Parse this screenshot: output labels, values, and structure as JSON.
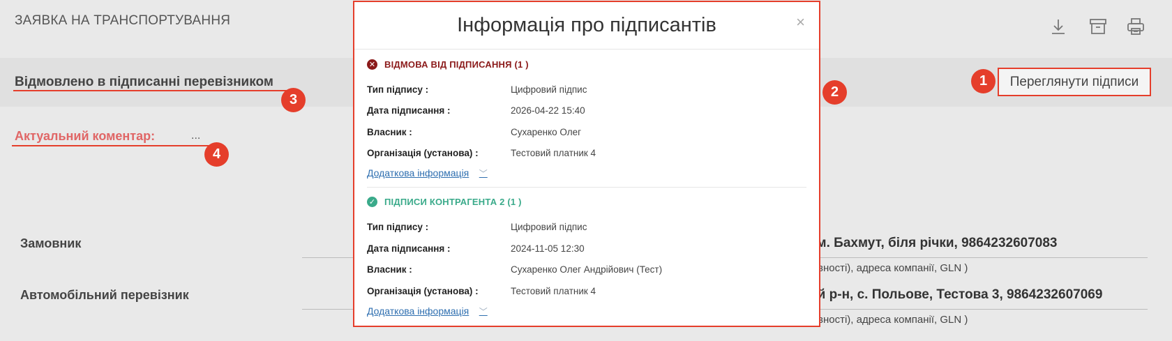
{
  "page": {
    "title": "ЗАЯВКА НА ТРАНСПОРТУВАННЯ",
    "status": "Відмовлено в підписанні перевізником",
    "view_signatures_button": "Переглянути підписи",
    "comment_label": "Актуальний коментар:",
    "comment_value": "..."
  },
  "toolbar": {
    "icons": [
      "download-icon",
      "archive-icon",
      "print-icon"
    ]
  },
  "badges": [
    "1",
    "2",
    "3",
    "4"
  ],
  "rows": [
    {
      "label": "Замовник",
      "value": ", м. Бахмут, біля річки, 9864232607083",
      "hint": "вності), адреса компанії, GLN )"
    },
    {
      "label": "Автомобільний перевізник",
      "value": "ий р-н, с. Польове, Тестова 3, 9864232607069",
      "hint": "вності), адреса компанії, GLN )"
    }
  ],
  "modal": {
    "title": "Інформація про підписантів",
    "close": "×",
    "sections": [
      {
        "title": "ВІДМОВА ВІД ПІДПИСАННЯ (1 )",
        "status": "rejected",
        "rows": [
          {
            "key": "Тип підпису :",
            "value": "Цифровий підпис"
          },
          {
            "key": "Дата підписання :",
            "value": "2026-04-22 15:40"
          },
          {
            "key": "Власник :",
            "value": "Сухаренко Олег"
          },
          {
            "key": "Організація (установа) :",
            "value": "Тестовий платник 4"
          }
        ],
        "more": "Додаткова інформація"
      },
      {
        "title": "ПІДПИСИ КОНТРАГЕНТА 2 (1 )",
        "status": "signed",
        "rows": [
          {
            "key": "Тип підпису :",
            "value": "Цифровий підпис"
          },
          {
            "key": "Дата підписання :",
            "value": "2024-11-05 12:30"
          },
          {
            "key": "Власник :",
            "value": "Сухаренко Олег Андрійович (Тест)"
          },
          {
            "key": "Організація (установа) :",
            "value": "Тестовий платник 4"
          }
        ],
        "more": "Додаткова інформація"
      }
    ]
  },
  "colors": {
    "accent_red": "#e53e2b",
    "reject": "#8b1a1a",
    "signed": "#3aaa8a",
    "link": "#2f6fb0"
  }
}
